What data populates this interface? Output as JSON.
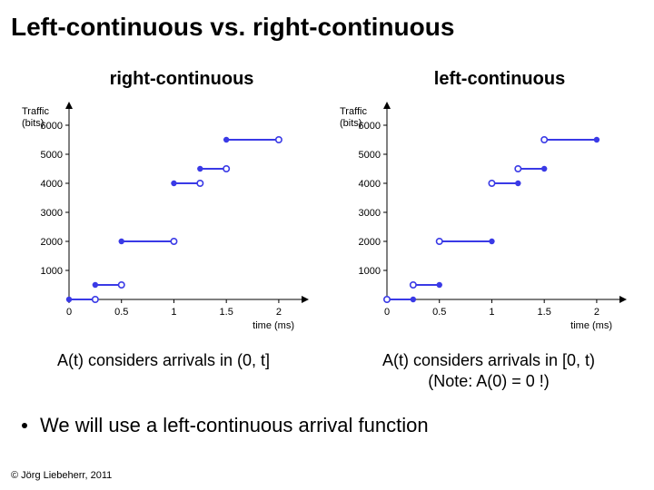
{
  "title": "Left-continuous vs. right-continuous",
  "left_col_label": "right-continuous",
  "right_col_label": "left-continuous",
  "left_caption": "A(t) considers arrivals in (0, t]",
  "right_caption_l1": "A(t) considers arrivals in [0, t)",
  "right_caption_l2": "(Note: A(0) = 0 !)",
  "bullet": "We will use a left-continuous arrival function",
  "copyright": "© Jörg Liebeherr, 2011",
  "axis": {
    "ylabel_l1": "Traffic",
    "ylabel_l2": "(bits)",
    "xlabel": "time (ms)",
    "yticks": [
      "1000",
      "2000",
      "3000",
      "4000",
      "5000",
      "6000"
    ],
    "xticks": [
      "0",
      "0.5",
      "1",
      "1.5",
      "2"
    ]
  },
  "chart_data": [
    {
      "type": "step",
      "name": "right-continuous",
      "xlabel": "time (ms)",
      "ylabel": "Traffic (bits)",
      "xlim": [
        0,
        2.2
      ],
      "ylim": [
        0,
        6500
      ],
      "segments": [
        {
          "x0": 0.0,
          "x1": 0.25,
          "y": 0,
          "closed_at": "left"
        },
        {
          "x0": 0.25,
          "x1": 0.5,
          "y": 500,
          "closed_at": "left"
        },
        {
          "x0": 0.5,
          "x1": 1.0,
          "y": 2000,
          "closed_at": "left"
        },
        {
          "x0": 1.0,
          "x1": 1.25,
          "y": 4000,
          "closed_at": "left"
        },
        {
          "x0": 1.25,
          "x1": 1.5,
          "y": 4500,
          "closed_at": "left"
        },
        {
          "x0": 1.5,
          "x1": 2.0,
          "y": 5500,
          "closed_at": "left"
        }
      ]
    },
    {
      "type": "step",
      "name": "left-continuous",
      "xlabel": "time (ms)",
      "ylabel": "Traffic (bits)",
      "xlim": [
        0,
        2.2
      ],
      "ylim": [
        0,
        6500
      ],
      "segments": [
        {
          "x0": 0.0,
          "x1": 0.25,
          "y": 0,
          "closed_at": "right"
        },
        {
          "x0": 0.25,
          "x1": 0.5,
          "y": 500,
          "closed_at": "right"
        },
        {
          "x0": 0.5,
          "x1": 1.0,
          "y": 2000,
          "closed_at": "right"
        },
        {
          "x0": 1.0,
          "x1": 1.25,
          "y": 4000,
          "closed_at": "right"
        },
        {
          "x0": 1.25,
          "x1": 1.5,
          "y": 4500,
          "closed_at": "right"
        },
        {
          "x0": 1.5,
          "x1": 2.0,
          "y": 5500,
          "closed_at": "right"
        }
      ]
    }
  ]
}
